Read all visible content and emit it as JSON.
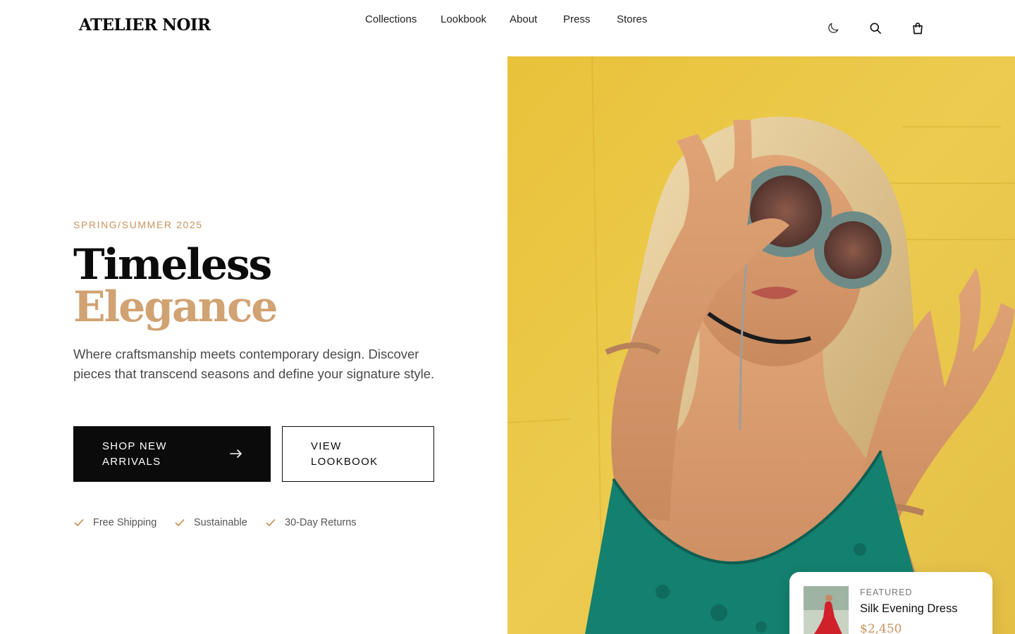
{
  "brand": {
    "name": "ATELIER NOIR"
  },
  "nav": {
    "items": [
      {
        "label": "Collections"
      },
      {
        "label": "Lookbook"
      },
      {
        "label": "About"
      },
      {
        "label": "Press"
      },
      {
        "label": "Stores"
      }
    ]
  },
  "header_icons": [
    "moon-icon",
    "search-icon",
    "shopping-bag-icon"
  ],
  "hero": {
    "eyebrow": "SPRING/SUMMER 2025",
    "headline_line1": "Timeless",
    "headline_line2": "Elegance",
    "description": "Where craftsmanship meets contemporary design. Discover pieces that transcend seasons and define your signature style.",
    "primary_cta": "SHOP NEW ARRIVALS",
    "primary_cta_icon": "arrow-right-icon",
    "secondary_cta": "VIEW LOOKBOOK",
    "perks": [
      {
        "label": "Free Shipping"
      },
      {
        "label": "Sustainable"
      },
      {
        "label": "30-Day Returns"
      }
    ]
  },
  "featured": {
    "eyebrow": "FEATURED",
    "title": "Silk Evening Dress",
    "price": "$2,450"
  },
  "colors": {
    "accent": "#c9945e",
    "headline_accent": "#d1a272",
    "primary": "#0b0b0b",
    "hero_background": "#e8c440",
    "garment": "#14806f"
  }
}
